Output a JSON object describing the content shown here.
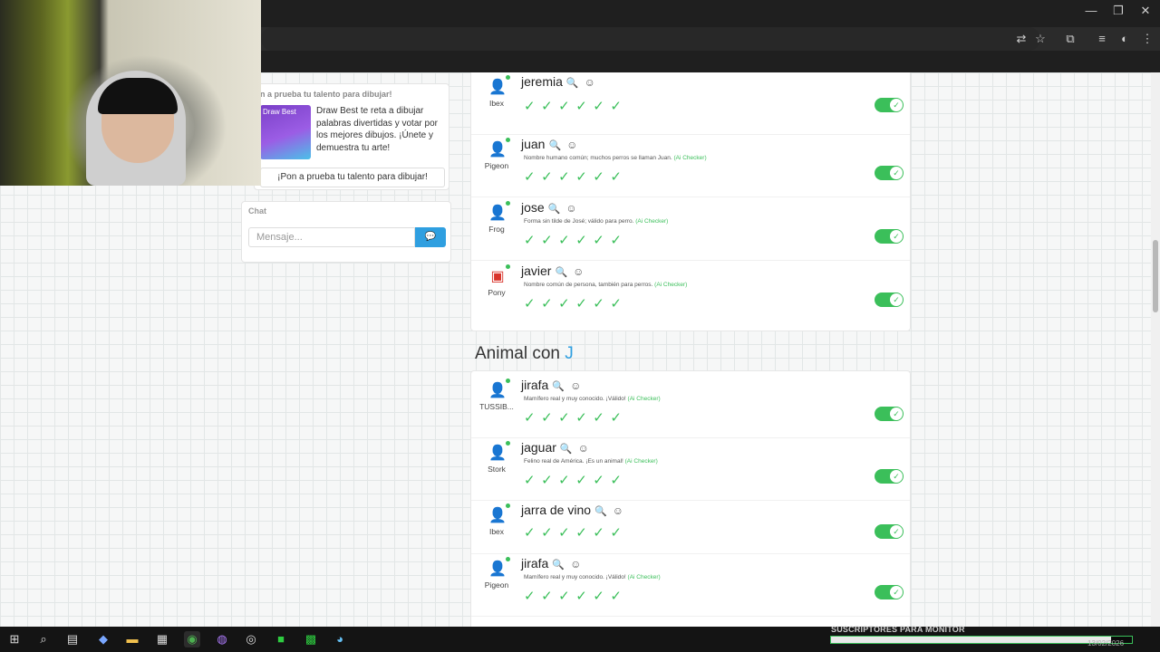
{
  "window": {
    "controls": {
      "minimize": "—",
      "maximize": "❐",
      "close": "✕"
    }
  },
  "promo": {
    "title": "n a prueba tu talento para dibujar!",
    "image_label": "Draw Best",
    "text": "Draw Best te reta a dibujar palabras divertidas y votar por los mejores dibujos. ¡Únete y demuestra tu arte!",
    "button": "¡Pon a prueba tu talento para dibujar!"
  },
  "chat": {
    "title": "Chat",
    "placeholder": "Mensaje..."
  },
  "ai_tag": "(Ai Checker)",
  "checks": "✓✓✓✓✓✓",
  "sections": [
    {
      "entries": [
        {
          "word": "jeremia",
          "player": "Ibex",
          "reason": ""
        },
        {
          "word": "juan",
          "player": "Pigeon",
          "reason": "Nombre humano común; muchos perros se llaman Juan."
        },
        {
          "word": "jose",
          "player": "Frog",
          "reason": "Forma sin tilde de José; válido para perro."
        },
        {
          "word": "javier",
          "player": "Pony",
          "reason": "Nombre común de persona, también para perros."
        }
      ]
    },
    {
      "title": "Animal con",
      "letter": "J",
      "entries": [
        {
          "word": "jirafa",
          "player": "TUSSIB...",
          "reason": "Mamífero real y muy conocido. ¡Válido!"
        },
        {
          "word": "jaguar",
          "player": "Stork",
          "reason": "Felino real de América. ¡Es un animal!"
        },
        {
          "word": "jarra de vino",
          "player": "Ibex",
          "reason": ""
        },
        {
          "word": "jirafa",
          "player": "Pigeon",
          "reason": "Mamífero real y muy conocido. ¡Válido!"
        }
      ]
    }
  ],
  "taskbar": {
    "subscribers_label": "SUSCRIPTORES PARA MONITOR",
    "subscribers_progress": 0.93,
    "date": "13/02/2026"
  },
  "colors": {
    "accent": "#2f9fe0",
    "valid": "#3bbf5a"
  }
}
